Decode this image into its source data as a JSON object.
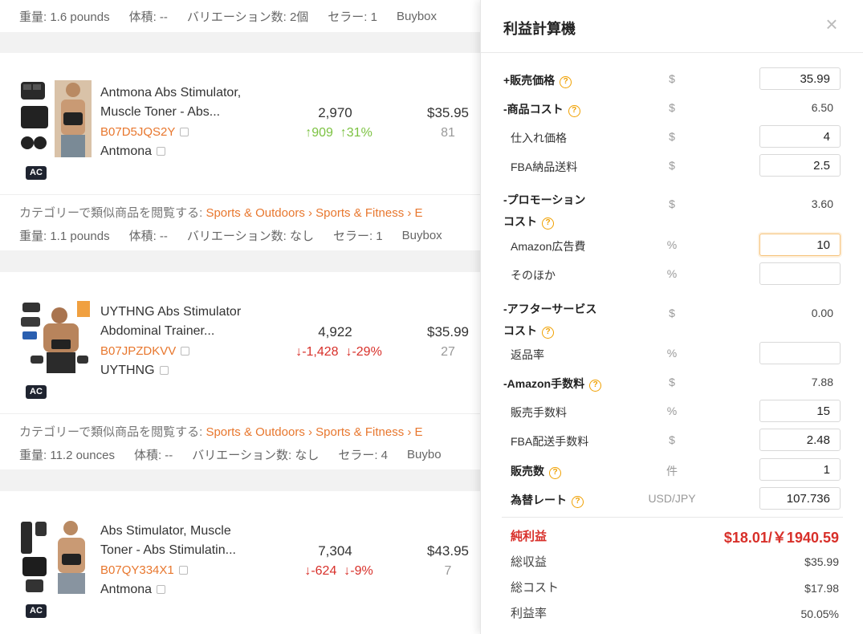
{
  "top_meta": {
    "weight": "重量: 1.6 pounds",
    "volume": "体積: --",
    "variations": "バリエーション数: 2個",
    "sellers": "セラー: 1",
    "buybox": "Buybox"
  },
  "products": [
    {
      "title_l1": "Antmona Abs Stimulator,",
      "title_l2": "Muscle Toner - Abs...",
      "asin": "B07D5JQS2Y",
      "brand": "Antmona",
      "badge": "AC",
      "rank": "2,970",
      "delta_rank": "↑909",
      "delta_pct": "↑31%",
      "trend": "up",
      "price": "$35.95",
      "sub": "81",
      "category_prefix": "カテゴリーで類似商品を閲覧する: ",
      "category_links": "Sports & Outdoors › Sports & Fitness › E",
      "meta": {
        "weight": "重量: 1.1 pounds",
        "volume": "体積: --",
        "variations": "バリエーション数: なし",
        "sellers": "セラー: 1",
        "buybox": "Buybox"
      }
    },
    {
      "title_l1": "UYTHNG Abs Stimulator",
      "title_l2": "Abdominal Trainer...",
      "asin": "B07JPZDKVV",
      "brand": "UYTHNG",
      "badge": "AC",
      "rank": "4,922",
      "delta_rank": "↓-1,428",
      "delta_pct": "↓-29%",
      "trend": "down",
      "price": "$35.99",
      "sub": "27",
      "category_prefix": "カテゴリーで類似商品を閲覧する: ",
      "category_links": "Sports & Outdoors › Sports & Fitness › E",
      "meta": {
        "weight": "重量: 11.2 ounces",
        "volume": "体積: --",
        "variations": "バリエーション数: なし",
        "sellers": "セラー: 4",
        "buybox": "Buybo"
      }
    },
    {
      "title_l1": "Abs Stimulator, Muscle",
      "title_l2": "Toner - Abs Stimulatin...",
      "asin": "B07QY334X1",
      "brand": "Antmona",
      "badge": "AC",
      "rank": "7,304",
      "delta_rank": "↓-624",
      "delta_pct": "↓-9%",
      "trend": "down",
      "price": "$43.95",
      "sub": "7"
    }
  ],
  "calc": {
    "title": "利益計算機",
    "close": "×",
    "sale_price": {
      "label": "+販売価格",
      "unit": "$",
      "value": "35.99"
    },
    "product_cost": {
      "label": "-商品コスト",
      "unit": "$",
      "value": "6.50"
    },
    "purchase_price": {
      "label": "仕入れ価格",
      "unit": "$",
      "value": "4"
    },
    "fba_inbound": {
      "label": "FBA納品送料",
      "unit": "$",
      "value": "2.5"
    },
    "promo_cost": {
      "label_l1": "-プロモーション",
      "label_l2": "コスト",
      "unit": "$",
      "value": "3.60"
    },
    "amazon_ads": {
      "label": "Amazon広告費",
      "unit": "%",
      "value": "10"
    },
    "other": {
      "label": "そのほか",
      "unit": "%",
      "value": ""
    },
    "after_service": {
      "label_l1": "-アフターサービス",
      "label_l2": "コスト",
      "unit": "$",
      "value": "0.00"
    },
    "return_rate": {
      "label": "返品率",
      "unit": "%",
      "value": ""
    },
    "amazon_fee": {
      "label": "-Amazon手数料",
      "unit": "$",
      "value": "7.88"
    },
    "sales_fee": {
      "label": "販売手数料",
      "unit": "%",
      "value": "15"
    },
    "fba_fee": {
      "label": "FBA配送手数料",
      "unit": "$",
      "value": "2.48"
    },
    "quantity": {
      "label": "販売数",
      "unit": "件",
      "value": "1"
    },
    "exchange": {
      "label": "為替レート",
      "unit": "USD/JPY",
      "value": "107.736"
    },
    "net_profit": {
      "label": "純利益",
      "value": "$18.01/￥1940.59"
    },
    "gross_revenue": {
      "label": "総収益",
      "value": "$35.99"
    },
    "total_cost": {
      "label": "総コスト",
      "value": "$17.98"
    },
    "profit_rate": {
      "label": "利益率",
      "value": "50.05%"
    }
  },
  "colors": {
    "accent_orange": "#e8772e",
    "up_green": "#7cc242",
    "down_red": "#d8302a",
    "help_icon": "#f0a000"
  }
}
